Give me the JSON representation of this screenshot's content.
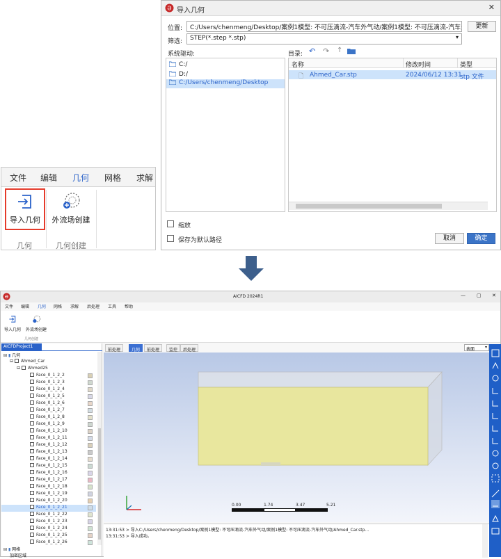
{
  "ribbon": {
    "tabs": [
      "文件",
      "编辑",
      "几何",
      "网格",
      "求解"
    ],
    "active_tab": "几何",
    "import_geometry_label": "导入几何",
    "external_flow_label": "外流场创建",
    "group_geometry": "几何",
    "group_geometry_create": "几何创建"
  },
  "dialog": {
    "title": "导入几何",
    "location_label": "位置:",
    "location_value": "C:/Users/chenmeng/Desktop/案例1模型: 不可压滴流-汽车外气动/案例1模型: 不可压滴流-汽车外气动",
    "update_button": "更新",
    "filter_label": "筛选:",
    "filter_value": "STEP(*.step *.stp)",
    "drives_label": "系统驱动:",
    "directory_label": "目录:",
    "drives": [
      "C:/",
      "D:/",
      "C:/Users/chenmeng/Desktop"
    ],
    "columns": [
      "名称",
      "修改时间",
      "类型"
    ],
    "file": {
      "name": "Ahmed_Car.stp",
      "modified": "2024/06/12 13:31",
      "type": "stp 文件"
    },
    "scale_label": "缩放",
    "save_default_label": "保存为默认路径",
    "cancel_button": "取消",
    "ok_button": "确定"
  },
  "app": {
    "title": "AICFD 2024R1",
    "menus": [
      "文件",
      "编辑",
      "几何",
      "网格",
      "求解",
      "后处理",
      "工具",
      "帮助"
    ],
    "active_menu": "几何",
    "toolbar_import": "导入几何",
    "toolbar_external": "外流场创建",
    "toolbar_group": "几何创建",
    "project_tab": "AICFDProject1",
    "tree": {
      "root": "几何",
      "car": "Ahmed_Car",
      "body": "Ahmed25",
      "faces": [
        "Face_0_1_2_2",
        "Face_0_1_2_3",
        "Face_0_1_2_4",
        "Face_0_1_2_5",
        "Face_0_1_2_6",
        "Face_0_1_2_7",
        "Face_0_1_2_8",
        "Face_0_1_2_9",
        "Face_0_1_2_10",
        "Face_0_1_2_11",
        "Face_0_1_2_12",
        "Face_0_1_2_13",
        "Face_0_1_2_14",
        "Face_0_1_2_15",
        "Face_0_1_2_16",
        "Face_0_1_2_17",
        "Face_0_1_2_18",
        "Face_0_1_2_19",
        "Face_0_1_2_20",
        "Face_0_1_2_21",
        "Face_0_1_2_22",
        "Face_0_1_2_23",
        "Face_0_1_2_24",
        "Face_0_1_2_25",
        "Face_0_1_2_26"
      ],
      "face_colors": [
        "#d9d0b5",
        "#cfd8cf",
        "#e0d8c8",
        "#d7d7e6",
        "#e8d6c8",
        "#d2dde3",
        "#e3e0c9",
        "#cdd6cf",
        "#dcd2c6",
        "#d4dbe8",
        "#d9cfb9",
        "#c9c9c9",
        "#e6dccd",
        "#cbd9d2",
        "#d9d5e8",
        "#e9b8c4",
        "#d6e2cb",
        "#d0d3e0",
        "#e6cfb0",
        "#cfdde8",
        "#dfe4cf",
        "#d6d3e6",
        "#cfe2d2",
        "#e4d2c6",
        "#cde3da"
      ],
      "selected_face": "Face_0_1_2_21",
      "mesh": "网格",
      "region": "加密区域"
    },
    "view_tabs": [
      "前处理",
      "几何",
      "前处理",
      "监控",
      "后处理"
    ],
    "active_view_tab": "几何",
    "view_select": "表面",
    "scale_ticks": [
      "0.00",
      "1.74",
      "3.47",
      "5.21"
    ],
    "console": [
      "13:31:53 > 导入C:/Users/chenmeng/Desktop/案例1模型: 不可压滴流-汽车外气动/案例1模型: 不可压滴流-汽车外气动/Ahmed_Car.stp...",
      "13:31:53 > 导入成功。"
    ],
    "colors": {
      "accent": "#2a62c9",
      "highlight": "#e53a2a",
      "box_fill": "#eae89a",
      "viewport_top": "#b8c8e6",
      "viewport_bottom": "#f3f5fb"
    }
  }
}
